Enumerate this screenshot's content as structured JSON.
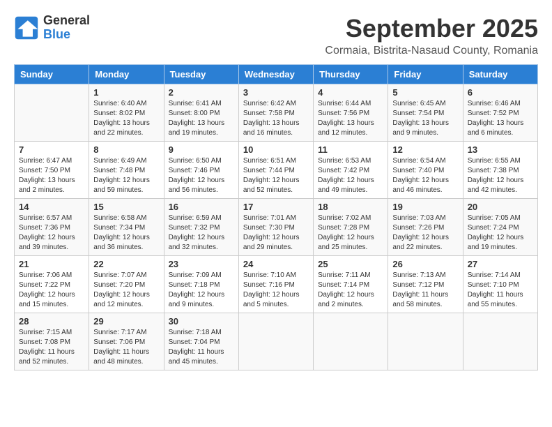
{
  "header": {
    "logo_line1": "General",
    "logo_line2": "Blue",
    "title": "September 2025",
    "subtitle": "Cormaia, Bistrita-Nasaud County, Romania"
  },
  "weekdays": [
    "Sunday",
    "Monday",
    "Tuesday",
    "Wednesday",
    "Thursday",
    "Friday",
    "Saturday"
  ],
  "weeks": [
    [
      {
        "day": "",
        "info": ""
      },
      {
        "day": "1",
        "info": "Sunrise: 6:40 AM\nSunset: 8:02 PM\nDaylight: 13 hours\nand 22 minutes."
      },
      {
        "day": "2",
        "info": "Sunrise: 6:41 AM\nSunset: 8:00 PM\nDaylight: 13 hours\nand 19 minutes."
      },
      {
        "day": "3",
        "info": "Sunrise: 6:42 AM\nSunset: 7:58 PM\nDaylight: 13 hours\nand 16 minutes."
      },
      {
        "day": "4",
        "info": "Sunrise: 6:44 AM\nSunset: 7:56 PM\nDaylight: 13 hours\nand 12 minutes."
      },
      {
        "day": "5",
        "info": "Sunrise: 6:45 AM\nSunset: 7:54 PM\nDaylight: 13 hours\nand 9 minutes."
      },
      {
        "day": "6",
        "info": "Sunrise: 6:46 AM\nSunset: 7:52 PM\nDaylight: 13 hours\nand 6 minutes."
      }
    ],
    [
      {
        "day": "7",
        "info": "Sunrise: 6:47 AM\nSunset: 7:50 PM\nDaylight: 13 hours\nand 2 minutes."
      },
      {
        "day": "8",
        "info": "Sunrise: 6:49 AM\nSunset: 7:48 PM\nDaylight: 12 hours\nand 59 minutes."
      },
      {
        "day": "9",
        "info": "Sunrise: 6:50 AM\nSunset: 7:46 PM\nDaylight: 12 hours\nand 56 minutes."
      },
      {
        "day": "10",
        "info": "Sunrise: 6:51 AM\nSunset: 7:44 PM\nDaylight: 12 hours\nand 52 minutes."
      },
      {
        "day": "11",
        "info": "Sunrise: 6:53 AM\nSunset: 7:42 PM\nDaylight: 12 hours\nand 49 minutes."
      },
      {
        "day": "12",
        "info": "Sunrise: 6:54 AM\nSunset: 7:40 PM\nDaylight: 12 hours\nand 46 minutes."
      },
      {
        "day": "13",
        "info": "Sunrise: 6:55 AM\nSunset: 7:38 PM\nDaylight: 12 hours\nand 42 minutes."
      }
    ],
    [
      {
        "day": "14",
        "info": "Sunrise: 6:57 AM\nSunset: 7:36 PM\nDaylight: 12 hours\nand 39 minutes."
      },
      {
        "day": "15",
        "info": "Sunrise: 6:58 AM\nSunset: 7:34 PM\nDaylight: 12 hours\nand 36 minutes."
      },
      {
        "day": "16",
        "info": "Sunrise: 6:59 AM\nSunset: 7:32 PM\nDaylight: 12 hours\nand 32 minutes."
      },
      {
        "day": "17",
        "info": "Sunrise: 7:01 AM\nSunset: 7:30 PM\nDaylight: 12 hours\nand 29 minutes."
      },
      {
        "day": "18",
        "info": "Sunrise: 7:02 AM\nSunset: 7:28 PM\nDaylight: 12 hours\nand 25 minutes."
      },
      {
        "day": "19",
        "info": "Sunrise: 7:03 AM\nSunset: 7:26 PM\nDaylight: 12 hours\nand 22 minutes."
      },
      {
        "day": "20",
        "info": "Sunrise: 7:05 AM\nSunset: 7:24 PM\nDaylight: 12 hours\nand 19 minutes."
      }
    ],
    [
      {
        "day": "21",
        "info": "Sunrise: 7:06 AM\nSunset: 7:22 PM\nDaylight: 12 hours\nand 15 minutes."
      },
      {
        "day": "22",
        "info": "Sunrise: 7:07 AM\nSunset: 7:20 PM\nDaylight: 12 hours\nand 12 minutes."
      },
      {
        "day": "23",
        "info": "Sunrise: 7:09 AM\nSunset: 7:18 PM\nDaylight: 12 hours\nand 9 minutes."
      },
      {
        "day": "24",
        "info": "Sunrise: 7:10 AM\nSunset: 7:16 PM\nDaylight: 12 hours\nand 5 minutes."
      },
      {
        "day": "25",
        "info": "Sunrise: 7:11 AM\nSunset: 7:14 PM\nDaylight: 12 hours\nand 2 minutes."
      },
      {
        "day": "26",
        "info": "Sunrise: 7:13 AM\nSunset: 7:12 PM\nDaylight: 11 hours\nand 58 minutes."
      },
      {
        "day": "27",
        "info": "Sunrise: 7:14 AM\nSunset: 7:10 PM\nDaylight: 11 hours\nand 55 minutes."
      }
    ],
    [
      {
        "day": "28",
        "info": "Sunrise: 7:15 AM\nSunset: 7:08 PM\nDaylight: 11 hours\nand 52 minutes."
      },
      {
        "day": "29",
        "info": "Sunrise: 7:17 AM\nSunset: 7:06 PM\nDaylight: 11 hours\nand 48 minutes."
      },
      {
        "day": "30",
        "info": "Sunrise: 7:18 AM\nSunset: 7:04 PM\nDaylight: 11 hours\nand 45 minutes."
      },
      {
        "day": "",
        "info": ""
      },
      {
        "day": "",
        "info": ""
      },
      {
        "day": "",
        "info": ""
      },
      {
        "day": "",
        "info": ""
      }
    ]
  ]
}
